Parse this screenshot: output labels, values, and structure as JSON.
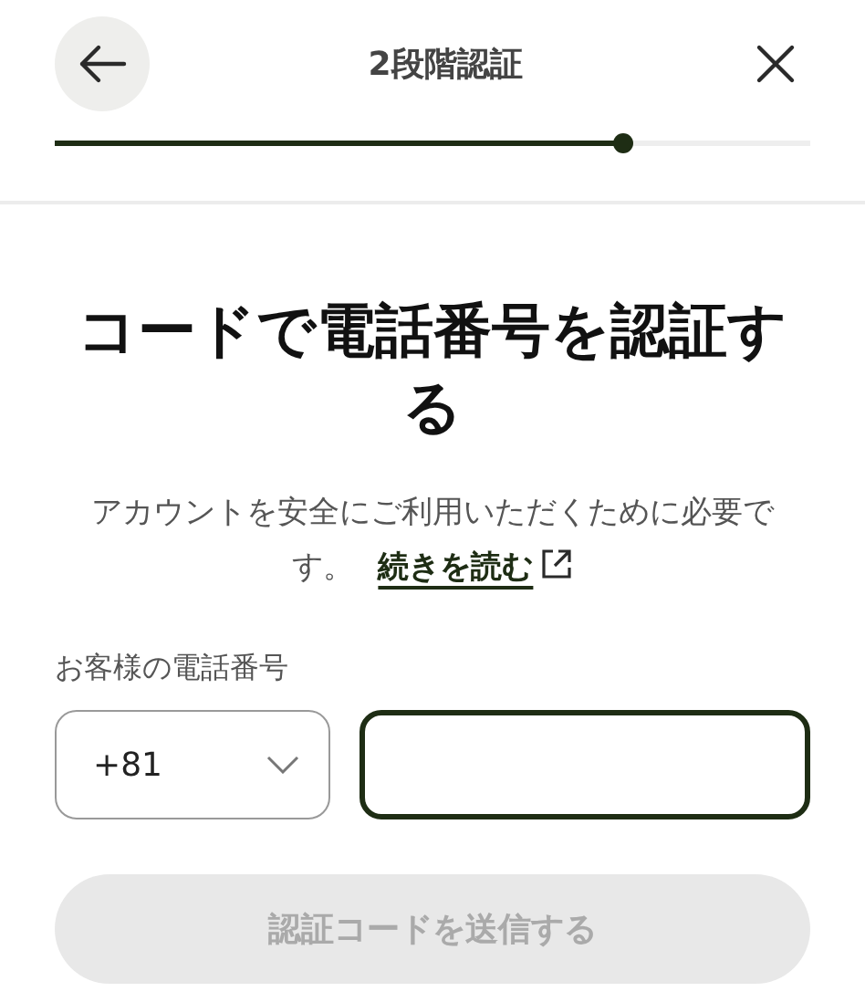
{
  "header": {
    "title": "2段階認証"
  },
  "progress": {
    "level": 0.75
  },
  "heading": "コードで電話番号を認証する",
  "description": {
    "text": "アカウントを安全にご利用いただくために必要です。",
    "link": "続きを読む"
  },
  "phone": {
    "label": "お客様の電話番号",
    "country_code": "+81"
  },
  "submit": {
    "label": "認証コードを送信する",
    "disabled": true
  }
}
